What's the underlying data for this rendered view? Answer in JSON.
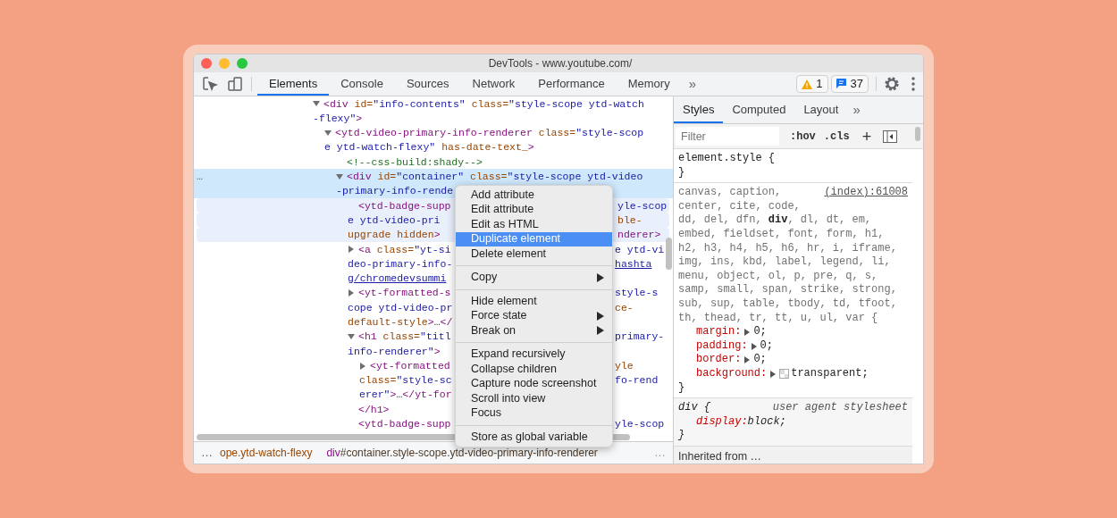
{
  "window": {
    "title": "DevTools - www.youtube.com/"
  },
  "toolbar": {
    "tabs": [
      {
        "label": "Elements",
        "selected": true
      },
      {
        "label": "Console",
        "selected": false
      },
      {
        "label": "Sources",
        "selected": false
      },
      {
        "label": "Network",
        "selected": false
      },
      {
        "label": "Performance",
        "selected": false
      },
      {
        "label": "Memory",
        "selected": false
      }
    ],
    "more": "»",
    "warnings": "1",
    "messages": "37"
  },
  "elements": {
    "nodes": [
      {
        "kind": "parent",
        "expanded": true,
        "selected": false,
        "hovered": false,
        "lines": [
          {
            "segments": [
              {
                "kind": "tag",
                "text": "<div "
              },
              {
                "kind": "attr",
                "text": "id="
              },
              {
                "kind": "value",
                "text": "\"info-contents\" "
              },
              {
                "kind": "attr",
                "text": "class="
              },
              {
                "kind": "value",
                "text": "\"style-scope ytd-watch"
              }
            ]
          },
          {
            "segments": [
              {
                "kind": "value",
                "text": "-flexy\""
              },
              {
                "kind": "tag",
                "text": ">"
              }
            ]
          }
        ],
        "children": [
          {
            "kind": "parent",
            "expanded": true,
            "selected": false,
            "hovered": false,
            "lines": [
              {
                "segments": [
                  {
                    "kind": "tag",
                    "text": "<ytd-video-primary-info-renderer "
                  },
                  {
                    "kind": "attr",
                    "text": "class="
                  },
                  {
                    "kind": "value",
                    "text": "\"style-scop"
                  }
                ]
              },
              {
                "segments": [
                  {
                    "kind": "value",
                    "text": "e ytd-watch-flexy\" "
                  },
                  {
                    "kind": "attr",
                    "text": "has-date-text_"
                  },
                  {
                    "kind": "tag",
                    "text": ">"
                  }
                ]
              }
            ],
            "children": [
              {
                "kind": "leaf",
                "selected": false,
                "hovered": false,
                "lines": [
                  {
                    "segments": [
                      {
                        "kind": "comment",
                        "text": "<!--css-build:shady-->"
                      }
                    ]
                  }
                ]
              },
              {
                "kind": "parent",
                "expanded": true,
                "selected": true,
                "hovered": false,
                "gutter": "…",
                "lines": [
                  {
                    "segments": [
                      {
                        "kind": "tag",
                        "text": "<div "
                      },
                      {
                        "kind": "attr",
                        "text": "id="
                      },
                      {
                        "kind": "value",
                        "text": "\"container\" "
                      },
                      {
                        "kind": "attr",
                        "text": "class="
                      },
                      {
                        "kind": "value",
                        "text": "\"style-scope ytd-video"
                      }
                    ]
                  },
                  {
                    "segments": [
                      {
                        "kind": "value",
                        "text": "-primary-info-rende"
                      }
                    ]
                  }
                ],
                "children": [
                  {
                    "kind": "leaf",
                    "selected": false,
                    "hovered": true,
                    "lines": [
                      {
                        "segments": [
                          {
                            "kind": "tag",
                            "text": "<ytd-badge-supp"
                          }
                        ],
                        "after_menu": [
                          {
                            "kind": "value",
                            "text": "yle-scop"
                          }
                        ]
                      },
                      {
                        "segments": [
                          {
                            "kind": "value",
                            "text": "e ytd-video-pri"
                          }
                        ],
                        "after_menu": [
                          {
                            "kind": "attr",
                            "text": "ble-"
                          }
                        ]
                      },
                      {
                        "segments": [
                          {
                            "kind": "attr",
                            "text": "upgrade hidden"
                          },
                          {
                            "kind": "tag",
                            "text": ">"
                          }
                        ],
                        "after_menu": [
                          {
                            "kind": "tag",
                            "text": "nderer>"
                          }
                        ]
                      }
                    ]
                  },
                  {
                    "kind": "parent",
                    "expanded": false,
                    "selected": false,
                    "hovered": false,
                    "lines": [
                      {
                        "segments": [
                          {
                            "kind": "tag",
                            "text": "<a "
                          },
                          {
                            "kind": "attr",
                            "text": "class="
                          },
                          {
                            "kind": "value",
                            "text": "\"yt-si"
                          }
                        ],
                        "after_menu": [
                          {
                            "kind": "value",
                            "text": "e ytd-vi"
                          }
                        ]
                      },
                      {
                        "segments": [
                          {
                            "kind": "value",
                            "text": "deo-primary-info-"
                          }
                        ],
                        "after_menu": [
                          {
                            "kind": "link",
                            "text": "hashta"
                          }
                        ]
                      },
                      {
                        "segments": [
                          {
                            "kind": "link",
                            "text": "g/chromedevsummi"
                          }
                        ]
                      }
                    ]
                  },
                  {
                    "kind": "parent",
                    "expanded": false,
                    "selected": false,
                    "hovered": false,
                    "lines": [
                      {
                        "segments": [
                          {
                            "kind": "tag",
                            "text": "<yt-formatted-s"
                          }
                        ],
                        "after_menu": [
                          {
                            "kind": "value",
                            "text": "style-s"
                          }
                        ]
                      },
                      {
                        "segments": [
                          {
                            "kind": "value",
                            "text": "cope ytd-video-pr"
                          }
                        ],
                        "after_menu": [
                          {
                            "kind": "attr",
                            "text": "ce-"
                          }
                        ]
                      },
                      {
                        "segments": [
                          {
                            "kind": "attr",
                            "text": "default-style"
                          },
                          {
                            "kind": "tag",
                            "text": ">"
                          },
                          {
                            "kind": "text",
                            "text": "…"
                          },
                          {
                            "kind": "tag",
                            "text": "</"
                          }
                        ]
                      }
                    ]
                  },
                  {
                    "kind": "parent",
                    "expanded": true,
                    "selected": false,
                    "hovered": false,
                    "lines": [
                      {
                        "segments": [
                          {
                            "kind": "tag",
                            "text": "<h1 "
                          },
                          {
                            "kind": "attr",
                            "text": "class="
                          },
                          {
                            "kind": "value",
                            "text": "\"titl"
                          }
                        ],
                        "after_menu": [
                          {
                            "kind": "value",
                            "text": "primary-"
                          }
                        ]
                      },
                      {
                        "segments": [
                          {
                            "kind": "value",
                            "text": "info-renderer\""
                          },
                          {
                            "kind": "tag",
                            "text": ">"
                          }
                        ]
                      }
                    ],
                    "children": [
                      {
                        "kind": "parent",
                        "expanded": false,
                        "selected": false,
                        "hovered": false,
                        "lines": [
                          {
                            "segments": [
                              {
                                "kind": "tag",
                                "text": "<yt-formatted"
                              }
                            ],
                            "after_menu": [
                              {
                                "kind": "attr",
                                "text": "yle"
                              }
                            ]
                          },
                          {
                            "segments": [
                              {
                                "kind": "attr",
                                "text": "class="
                              },
                              {
                                "kind": "value",
                                "text": "\"style-sc"
                              }
                            ],
                            "after_menu": [
                              {
                                "kind": "value",
                                "text": "fo-rend"
                              }
                            ]
                          },
                          {
                            "segments": [
                              {
                                "kind": "value",
                                "text": "erer\""
                              },
                              {
                                "kind": "tag",
                                "text": ">"
                              },
                              {
                                "kind": "text",
                                "text": "…"
                              },
                              {
                                "kind": "tag",
                                "text": "</yt-for"
                              }
                            ]
                          }
                        ]
                      }
                    ],
                    "closing": [
                      {
                        "segments": [
                          {
                            "kind": "tag",
                            "text": "</h1>"
                          }
                        ]
                      }
                    ]
                  },
                  {
                    "kind": "leaf",
                    "selected": false,
                    "hovered": false,
                    "lines": [
                      {
                        "segments": [
                          {
                            "kind": "tag",
                            "text": "<ytd-badge-supp"
                          }
                        ],
                        "after_menu": [
                          {
                            "kind": "value",
                            "text": "yle-scop"
                          }
                        ]
                      }
                    ]
                  }
                ]
              }
            ]
          }
        ]
      }
    ]
  },
  "context_menu": {
    "groups": [
      [
        {
          "label": "Add attribute",
          "selected": false,
          "submenu": false
        },
        {
          "label": "Edit attribute",
          "selected": false,
          "submenu": false
        },
        {
          "label": "Edit as HTML",
          "selected": false,
          "submenu": false
        },
        {
          "label": "Duplicate element",
          "selected": true,
          "submenu": false
        },
        {
          "label": "Delete element",
          "selected": false,
          "submenu": false
        }
      ],
      [
        {
          "label": "Copy",
          "selected": false,
          "submenu": true
        }
      ],
      [
        {
          "label": "Hide element",
          "selected": false,
          "submenu": false
        },
        {
          "label": "Force state",
          "selected": false,
          "submenu": true
        },
        {
          "label": "Break on",
          "selected": false,
          "submenu": true
        }
      ],
      [
        {
          "label": "Expand recursively",
          "selected": false,
          "submenu": false
        },
        {
          "label": "Collapse children",
          "selected": false,
          "submenu": false
        },
        {
          "label": "Capture node screenshot",
          "selected": false,
          "submenu": false
        },
        {
          "label": "Scroll into view",
          "selected": false,
          "submenu": false
        },
        {
          "label": "Focus",
          "selected": false,
          "submenu": false
        }
      ],
      [
        {
          "label": "Store as global variable",
          "selected": false,
          "submenu": false
        }
      ]
    ]
  },
  "breadcrumbs": {
    "leading": "…",
    "items": [
      {
        "segments": [
          {
            "kind": "class",
            "text": "ope.ytd-watch-flexy"
          }
        ]
      },
      {
        "segments": [
          {
            "kind": "tag",
            "text": "div"
          },
          {
            "kind": "plain",
            "text": "#container.style-scope.ytd-video-primary-info-renderer"
          }
        ]
      }
    ],
    "trailing": "…"
  },
  "styles_pane": {
    "tabs": [
      {
        "label": "Styles",
        "selected": true
      },
      {
        "label": "Computed",
        "selected": false
      },
      {
        "label": "Layout",
        "selected": false
      }
    ],
    "more": "»",
    "filter": {
      "placeholder": "Filter"
    },
    "hov": ":hov",
    "cls": ".cls",
    "add": "+",
    "rules": [
      {
        "kind": "inline",
        "selector_lines": [
          "element.style {"
        ],
        "closing": "}"
      },
      {
        "kind": "matched",
        "selector_lines": [
          "canvas, caption,",
          "center, cite, code,",
          "dd, del, dfn, **div**, dl, dt, em,",
          "embed, fieldset, font, form, h1,",
          "h2, h3, h4, h5, h6, hr, i, iframe,",
          "img, ins, kbd, label, legend, li,",
          "menu, object, ol, p, pre, q, s,",
          "samp, small, span, strike, strong,",
          "sub, sup, table, tbody, td, tfoot,",
          "th, thead, tr, tt, u, ul, var {"
        ],
        "source": "(index):61008",
        "properties": [
          {
            "name": "margin:",
            "value": "0;",
            "expandable": true,
            "swatch": false
          },
          {
            "name": "padding:",
            "value": "0;",
            "expandable": true,
            "swatch": false
          },
          {
            "name": "border:",
            "value": "0;",
            "expandable": true,
            "swatch": false
          },
          {
            "name": "background:",
            "value": "transparent;",
            "expandable": true,
            "swatch": true
          }
        ],
        "closing": "}"
      },
      {
        "kind": "user_agent",
        "selector_lines": [
          "div {"
        ],
        "source": "user agent stylesheet",
        "properties": [
          {
            "name": "display:",
            "value": "block;",
            "expandable": false,
            "swatch": false
          }
        ],
        "closing": "}"
      }
    ],
    "inherited": "Inherited from …"
  }
}
